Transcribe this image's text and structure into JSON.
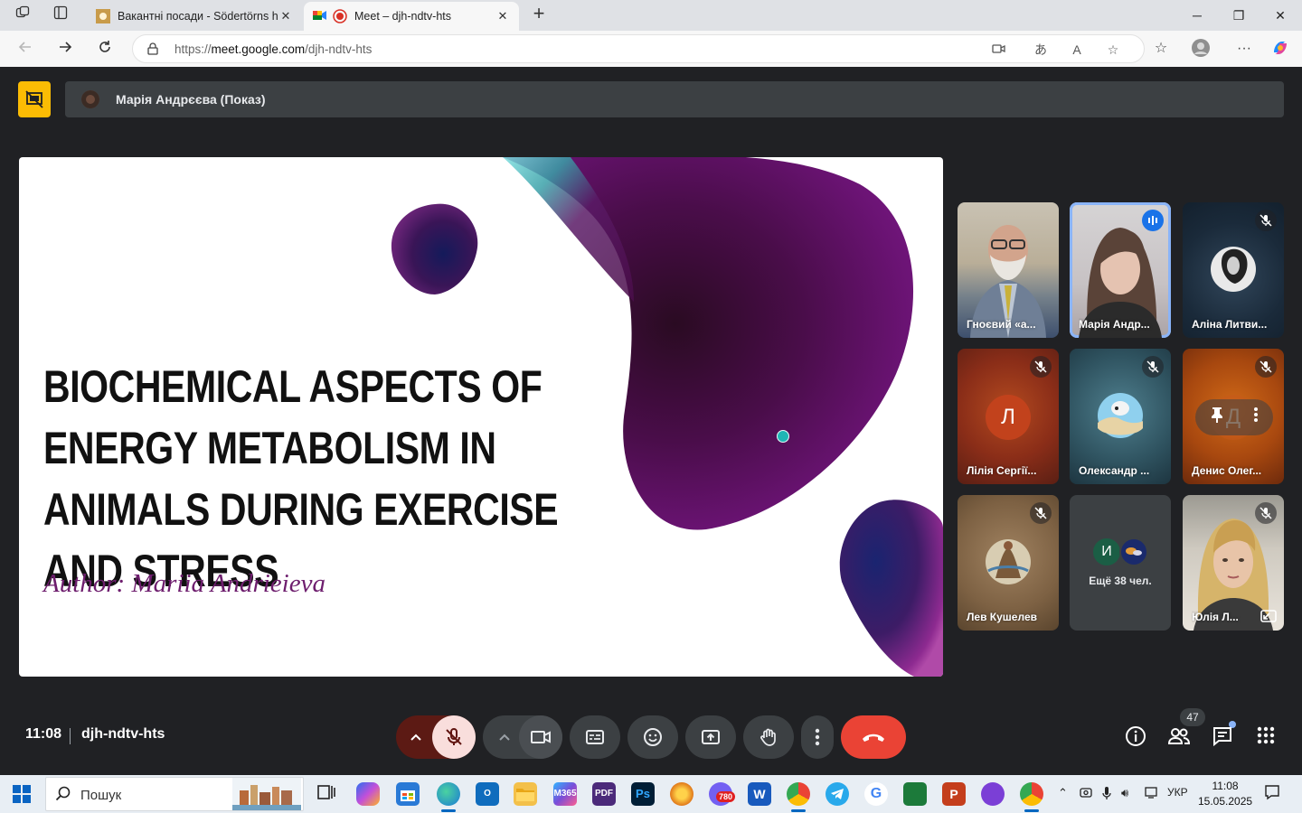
{
  "browser": {
    "tabs": [
      {
        "title": "Вакантні посади - Södertörns hö",
        "active": false
      },
      {
        "title": "Meet – djh-ndtv-hts",
        "active": true
      }
    ],
    "url_scheme": "https://",
    "url_host": "meet.google.com",
    "url_path": "/djh-ndtv-hts"
  },
  "meet": {
    "presenter_label": "Марія Андрєєва (Показ)",
    "slide": {
      "title": "Biochemical aspects of energy metabolism in animals during exercise and stress",
      "author": "Author: Mariia Andrieieva"
    },
    "participants": [
      {
        "name": "Гноєвий «а...",
        "muted": false,
        "kind": "video-man"
      },
      {
        "name": "Марія Андр...",
        "muted": false,
        "kind": "video-girl",
        "speaking": true
      },
      {
        "name": "Аліна Литви...",
        "muted": true,
        "kind": "avatar-photo"
      },
      {
        "name": "Лілія Сергії...",
        "muted": true,
        "kind": "letter",
        "letter": "Л"
      },
      {
        "name": "Олександр ...",
        "muted": true,
        "kind": "avatar-photo2"
      },
      {
        "name": "Денис Олег...",
        "muted": true,
        "kind": "letter",
        "letter": "Д"
      },
      {
        "name": "Лев Кушелев",
        "muted": true,
        "kind": "avatar-photo3"
      },
      {
        "name": "Ещё 38 чел.",
        "muted": false,
        "kind": "more",
        "letter": "И"
      },
      {
        "name": "Юлія Л...",
        "muted": true,
        "kind": "video-woman"
      }
    ],
    "time": "11:08",
    "meeting_code": "djh-ndtv-hts",
    "participants_count": "47",
    "colors": {
      "end_call": "#ea4335",
      "mic_off_bg": "#f9dedc",
      "present_badge": "#fbbc04",
      "speaking_ring": "#8ab4f8"
    }
  },
  "taskbar": {
    "search_placeholder": "Пошук",
    "lang": "УКР",
    "time": "11:08",
    "date": "15.05.2025",
    "viber_badge": "780"
  }
}
